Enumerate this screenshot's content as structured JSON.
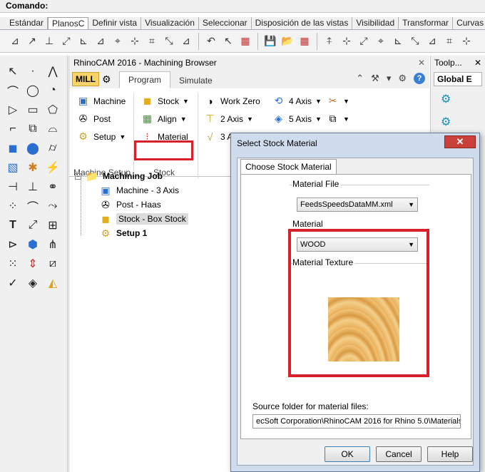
{
  "command": {
    "label": "Comando:"
  },
  "main_tabs": [
    "Estándar",
    "PlanosC",
    "Definir vista",
    "Visualización",
    "Seleccionar",
    "Disposición de las vistas",
    "Visibilidad",
    "Transformar",
    "Curvas"
  ],
  "active_main_tab": "PlanosC",
  "browser": {
    "title": "RhinoCAM 2016 - Machining Browser",
    "mill_label": "MILL",
    "tabs": [
      "Program",
      "Simulate"
    ],
    "ribbon": {
      "machine_setup": {
        "machine": "Machine",
        "post": "Post",
        "setup": "Setup",
        "group_label": "Machine Setup"
      },
      "stock": {
        "stock": "Stock",
        "align": "Align",
        "material": "Material",
        "group_label": "Stock"
      },
      "ops": {
        "work_zero": "Work Zero",
        "two_axis": "2 Axis",
        "three_axis": "3 A",
        "four_axis": "4 Axis",
        "five_axis": "5 Axis"
      }
    },
    "tree": {
      "job": "Machining Job",
      "machine": "Machine - 3 Axis",
      "post": "Post - Haas",
      "stock": "Stock - Box Stock",
      "setup": "Setup 1"
    }
  },
  "right_panel": {
    "title": "Toolp...",
    "tab": "Global E"
  },
  "dialog": {
    "title": "Select Stock Material",
    "close": "✕",
    "tab": "Choose Stock Material",
    "material_file_label": "Material File",
    "material_file_value": "FeedsSpeedsDataMM.xml",
    "material_label": "Material",
    "material_value": "WOOD",
    "texture_label": "Material Texture",
    "source_label": "Source folder for material files:",
    "source_value": "ecSoft Corporation\\RhinoCAM 2016 for Rhino 5.0\\Materials",
    "ok": "OK",
    "cancel": "Cancel",
    "help": "Help"
  },
  "colors": {
    "highlight": "#d8202a",
    "mill_badge": "#f7d36a"
  }
}
